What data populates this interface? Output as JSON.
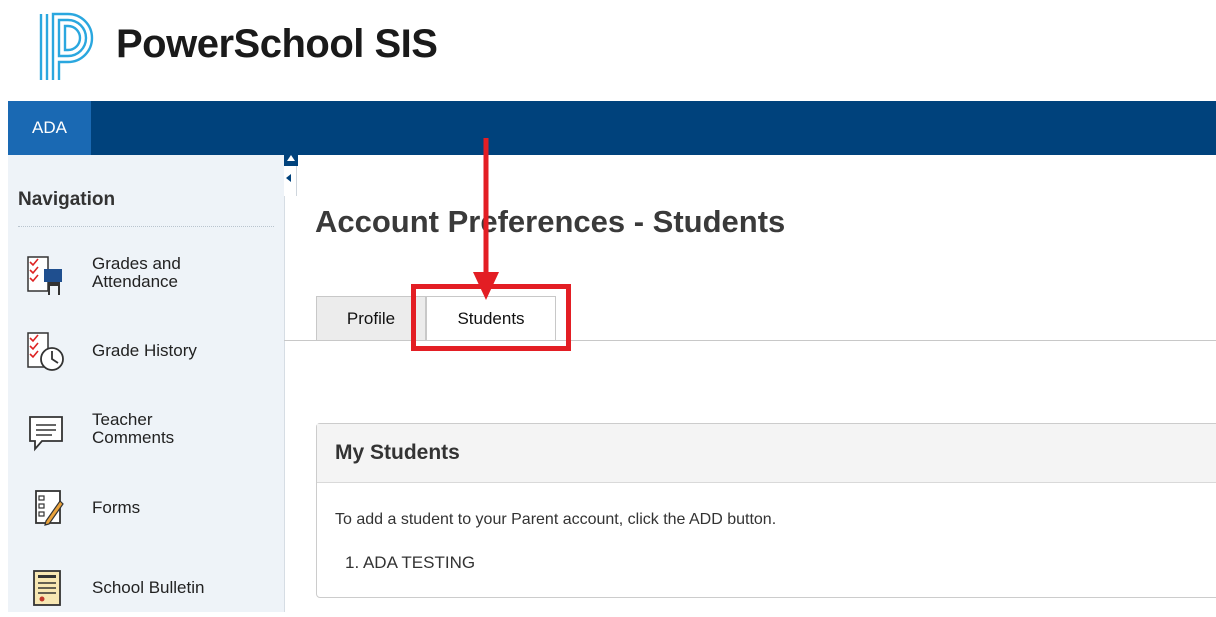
{
  "app": {
    "title": "PowerSchool SIS"
  },
  "topbar": {
    "active_tab": "ADA"
  },
  "sidebar": {
    "title": "Navigation",
    "items": [
      {
        "label_line1": "Grades and",
        "label_line2": "Attendance",
        "icon": "grades-attendance-icon"
      },
      {
        "label_line1": "Grade History",
        "label_line2": "",
        "icon": "grade-history-icon"
      },
      {
        "label_line1": "Teacher",
        "label_line2": "Comments",
        "icon": "teacher-comments-icon"
      },
      {
        "label_line1": "Forms",
        "label_line2": "",
        "icon": "forms-icon"
      },
      {
        "label_line1": "School Bulletin",
        "label_line2": "",
        "icon": "school-bulletin-icon"
      }
    ]
  },
  "main": {
    "page_title": "Account Preferences - Students",
    "tabs": [
      {
        "label": "Profile",
        "active": false
      },
      {
        "label": "Students",
        "active": true
      }
    ],
    "panel": {
      "title": "My Students",
      "instruction": "To add a student to your Parent account, click the ADD button.",
      "students": [
        "1. ADA TESTING"
      ]
    }
  },
  "colors": {
    "topbar": "#00427c",
    "active_topbar_tab": "#1a69b3",
    "annotation_red": "#e31e24",
    "logo_blue": "#2aa7df"
  }
}
